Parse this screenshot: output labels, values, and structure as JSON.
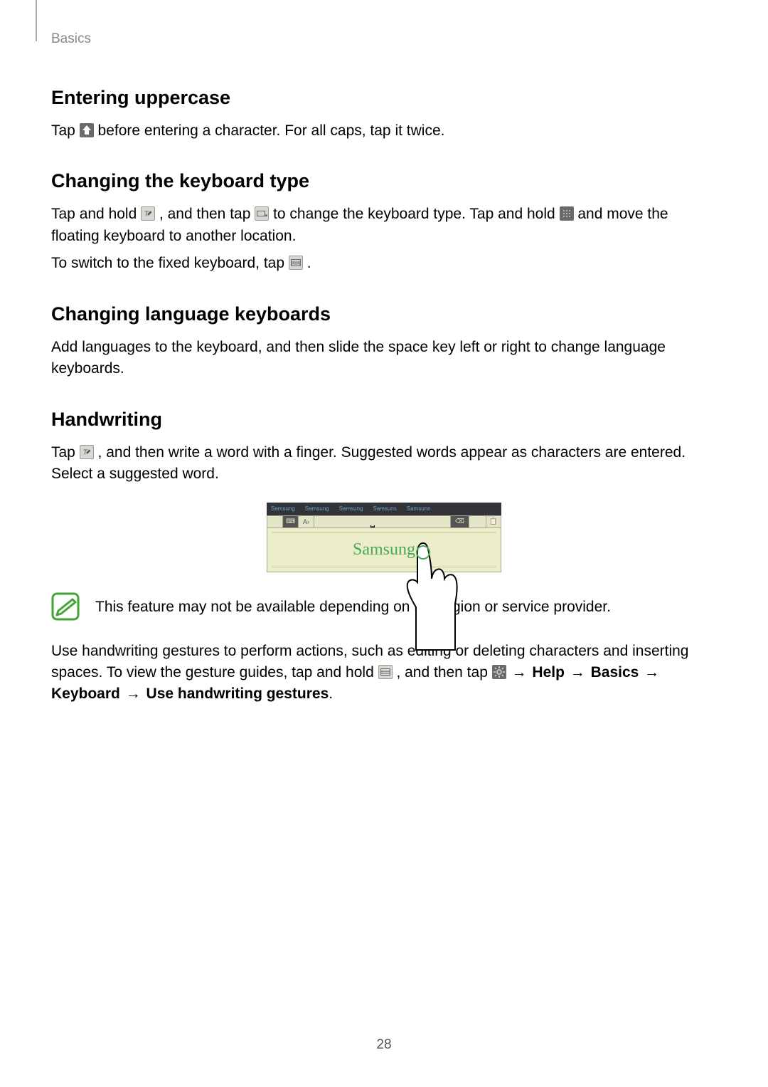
{
  "header": {
    "breadcrumb": "Basics"
  },
  "sections": {
    "uppercase": {
      "heading": "Entering uppercase",
      "p1_a": "Tap ",
      "p1_b": " before entering a character. For all caps, tap it twice."
    },
    "kbtype": {
      "heading": "Changing the keyboard type",
      "p1_a": "Tap and hold ",
      "p1_b": ", and then tap ",
      "p1_c": " to change the keyboard type. Tap and hold ",
      "p1_d": " and move the floating keyboard to another location.",
      "p2_a": "To switch to the fixed keyboard, tap ",
      "p2_b": "."
    },
    "lang": {
      "heading": "Changing language keyboards",
      "p1": "Add languages to the keyboard, and then slide the space key left or right to change language keyboards."
    },
    "hand": {
      "heading": "Handwriting",
      "p1_a": "Tap ",
      "p1_b": ", and then write a word with a finger. Suggested words appear as characters are entered. Select a suggested word.",
      "note": "This feature may not be available depending on the region or service provider.",
      "p2_a": "Use handwriting gestures to perform actions, such as editing or deleting characters and inserting spaces. To view the gesture guides, tap and hold ",
      "p2_b": ", and then tap ",
      "p2_arrow": " → ",
      "p2_help": "Help",
      "p2_basics": "Basics",
      "p2_keyboard": "Keyboard",
      "p2_use": "Use handwriting gestures",
      "p2_period": "."
    }
  },
  "illustration": {
    "suggestions": [
      "Samsung",
      "Samsung",
      "Samsung",
      "Samsuns",
      "Samsunn"
    ],
    "handwriting": "Samsung"
  },
  "page_number": "28"
}
